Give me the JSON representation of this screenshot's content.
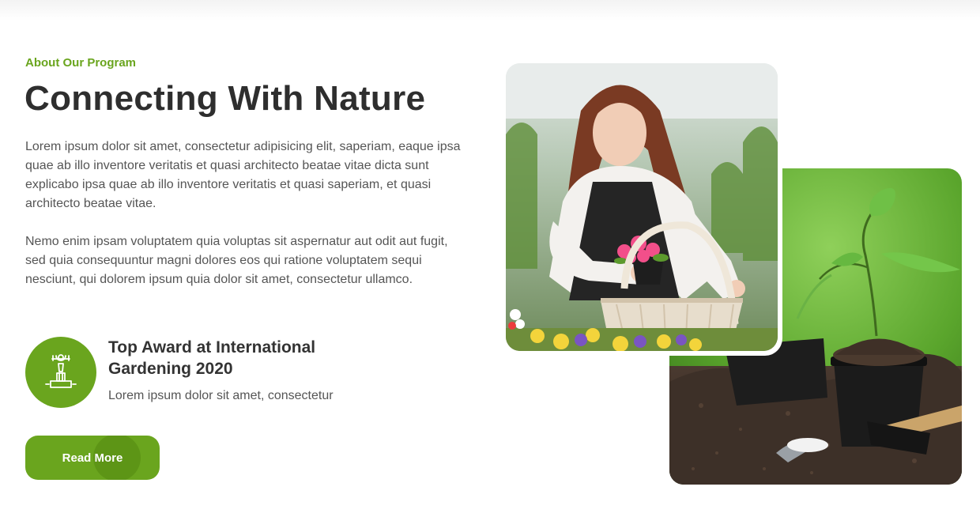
{
  "section": {
    "eyebrow": "About Our Program",
    "headline": "Connecting With Nature",
    "paragraphs": [
      "Lorem ipsum dolor sit amet, consectetur adipisicing elit, saperiam, eaque ipsa quae ab illo inventore veritatis et quasi architecto beatae vitae dicta sunt explicabo ipsa quae ab illo inventore veritatis et quasi saperiam, et quasi architecto beatae vitae.",
      "Nemo enim ipsam voluptatem quia voluptas sit aspernatur aut odit aut fugit, sed quia consequuntur magni dolores eos qui ratione voluptatem sequi nesciunt, qui dolorem ipsum quia dolor sit amet, consectetur ullamco."
    ],
    "award": {
      "icon": "trophy-award-icon",
      "title": "Top Award at International Gardening 2020",
      "text": "Lorem ipsum dolor sit amet, consectetur"
    },
    "button_label": "Read More"
  },
  "images": {
    "front": "woman-gardener-photo",
    "back": "seedling-pot-photo"
  },
  "colors": {
    "accent": "#6aa51e",
    "heading": "#2e2e2e",
    "body_text": "#555555"
  }
}
